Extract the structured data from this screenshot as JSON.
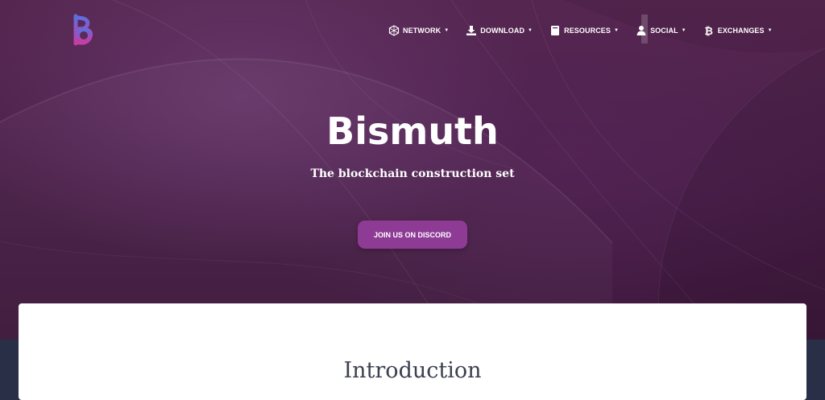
{
  "brand": {
    "logo_icon": "bismuth-logo-icon",
    "colors": {
      "logo_top": "#5b6fe0",
      "logo_bottom": "#c43ea6"
    }
  },
  "nav": {
    "items": [
      {
        "label": "NETWORK",
        "icon": "network-icon"
      },
      {
        "label": "DOWNLOAD",
        "icon": "download-icon"
      },
      {
        "label": "RESOURCES",
        "icon": "book-icon"
      },
      {
        "label": "SOCIAL",
        "icon": "users-icon"
      },
      {
        "label": "EXCHANGES",
        "icon": "bitcoin-icon"
      }
    ]
  },
  "hero": {
    "title": "Bismuth",
    "subtitle": "The blockchain construction set",
    "cta_label": "JOIN US ON DISCORD",
    "colors": {
      "background": "#4a1f48",
      "cta": "#8e3b96"
    }
  },
  "content": {
    "heading": "Introduction"
  }
}
